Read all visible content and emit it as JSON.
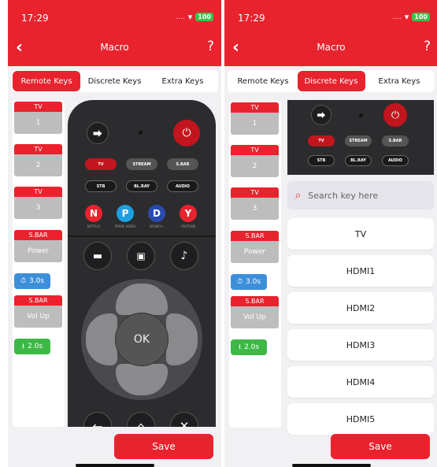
{
  "status": {
    "time": "17:29",
    "battery": "100"
  },
  "nav": {
    "title": "Macro",
    "help": "?"
  },
  "tabs": [
    "Remote Keys",
    "Discrete Keys",
    "Extra Keys"
  ],
  "macros": [
    {
      "tag": "TV",
      "value": "1"
    },
    {
      "tag": "TV",
      "value": "2"
    },
    {
      "tag": "TV",
      "value": "3"
    },
    {
      "tag": "S.BAR",
      "value": "Power"
    },
    {
      "delay": "3.0s"
    },
    {
      "tag": "S.BAR",
      "value": "Vol Up"
    },
    {
      "delay": "2.0s"
    }
  ],
  "remote": {
    "source_row": [
      "TV",
      "STREAM",
      "S.BAR"
    ],
    "device_row": [
      "STB",
      "BL.RAY",
      "AUDIO"
    ],
    "apps": [
      {
        "letter": "N",
        "label": "NETFLIX",
        "color": "#e8232e"
      },
      {
        "letter": "P",
        "label": "PRIME VIDEO",
        "color": "#1ea0e0"
      },
      {
        "letter": "D",
        "label": "DISNEY+",
        "color": "#2b4ab0"
      },
      {
        "letter": "Y",
        "label": "YOUTUBE",
        "color": "#e8232e"
      }
    ],
    "ok": "OK"
  },
  "search": {
    "placeholder": "Search key here"
  },
  "keys": [
    "TV",
    "HDMI1",
    "HDMI2",
    "HDMI3",
    "HDMI4",
    "HDMI5"
  ],
  "save": "Save",
  "colors": {
    "accent": "#e8232e",
    "timer": "#3d8fd9",
    "download": "#3db846"
  }
}
